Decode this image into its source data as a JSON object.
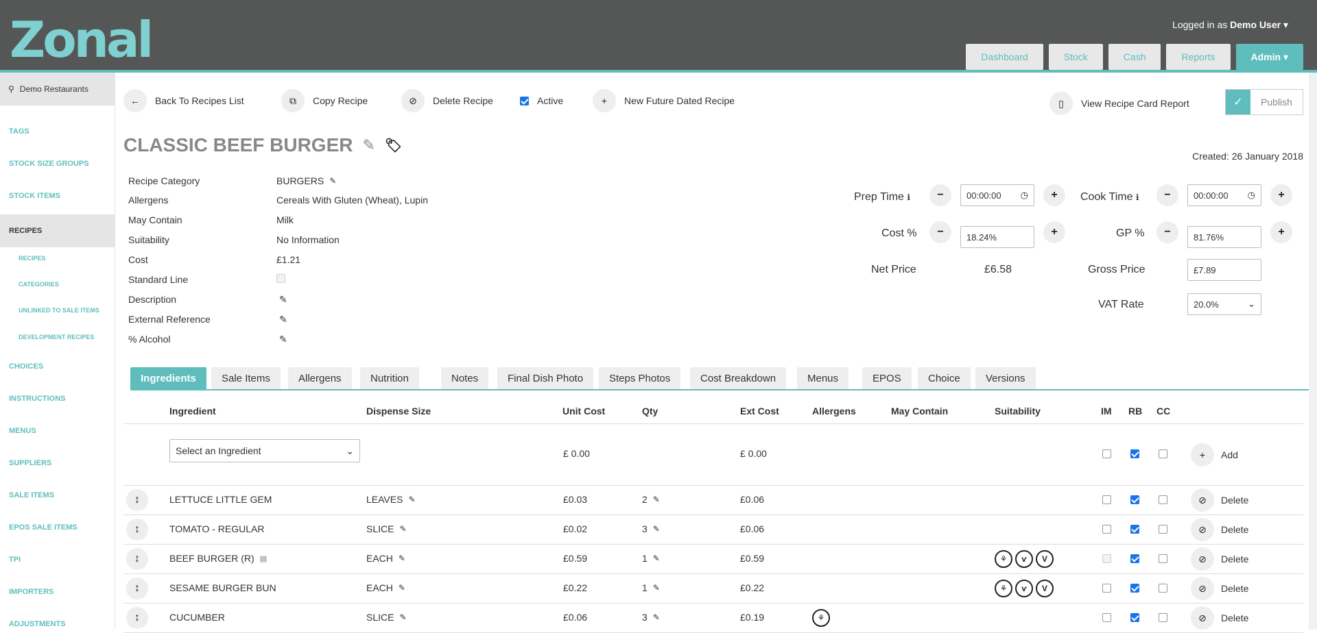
{
  "header": {
    "logo": "Zonal",
    "user_prefix": "Logged in as",
    "user_name": "Demo User",
    "nav": [
      "Dashboard",
      "Stock",
      "Cash",
      "Reports",
      "Admin"
    ]
  },
  "sidebar": {
    "site": "Demo Restaurants",
    "items": [
      "TAGS",
      "STOCK SIZE GROUPS",
      "STOCK ITEMS",
      "RECIPES",
      "CHOICES",
      "INSTRUCTIONS",
      "MENUS",
      "SUPPLIERS",
      "SALE ITEMS",
      "EPOS SALE ITEMS",
      "TPI",
      "IMPORTERS",
      "ADJUSTMENTS"
    ],
    "sub_items": [
      "RECIPES",
      "CATEGORIES",
      "UNLINKED TO SALE ITEMS",
      "DEVELOPMENT RECIPES"
    ]
  },
  "toolbar": {
    "back": "Back To Recipes List",
    "copy": "Copy Recipe",
    "delete": "Delete Recipe",
    "active": "Active",
    "new_future": "New Future Dated Recipe",
    "view_report": "View Recipe Card Report",
    "publish": "Publish"
  },
  "recipe": {
    "title": "CLASSIC BEEF BURGER",
    "created": "Created: 26 January 2018",
    "props": [
      {
        "label": "Recipe Category",
        "value": "BURGERS"
      },
      {
        "label": "Allergens",
        "value": "Cereals With Gluten (Wheat), Lupin"
      },
      {
        "label": "May Contain",
        "value": "Milk"
      },
      {
        "label": "Suitability",
        "value": "No Information"
      },
      {
        "label": "Cost",
        "value": "£1.21"
      },
      {
        "label": "Standard Line",
        "value": ""
      },
      {
        "label": "Description",
        "value": ""
      },
      {
        "label": "External Reference",
        "value": ""
      },
      {
        "label": "% Alcohol",
        "value": ""
      }
    ]
  },
  "pricing": {
    "prep_time_label": "Prep Time",
    "prep_time": "00:00:00",
    "cook_time_label": "Cook Time",
    "cook_time": "00:00:00",
    "cost_pct_label": "Cost %",
    "cost_pct": "18.24%",
    "gp_pct_label": "GP %",
    "gp_pct": "81.76%",
    "net_price_label": "Net Price",
    "net_price": "£6.58",
    "gross_price_label": "Gross Price",
    "gross_price": "£7.89",
    "vat_label": "VAT Rate",
    "vat": "20.0%"
  },
  "tabs": [
    "Ingredients",
    "Sale Items",
    "Allergens",
    "Nutrition",
    "Notes",
    "Final Dish Photo",
    "Steps Photos",
    "Cost Breakdown",
    "Menus",
    "EPOS",
    "Choice",
    "Versions"
  ],
  "table": {
    "columns": [
      "Ingredient",
      "Dispense Size",
      "Unit Cost",
      "Qty",
      "Ext Cost",
      "Allergens",
      "May Contain",
      "Suitability",
      "IM",
      "RB",
      "CC"
    ],
    "new_row": {
      "placeholder": "Select an Ingredient",
      "unit_cost": "£ 0.00",
      "ext_cost": "£ 0.00",
      "action": "Add"
    },
    "rows": [
      {
        "ingredient": "LETTUCE LITTLE GEM",
        "size": "LEAVES",
        "unit_cost": "£0.03",
        "qty": "2",
        "ext_cost": "£0.06",
        "action": "Delete"
      },
      {
        "ingredient": "TOMATO - REGULAR",
        "size": "SLICE",
        "unit_cost": "£0.02",
        "qty": "3",
        "ext_cost": "£0.06",
        "action": "Delete"
      },
      {
        "ingredient": "BEEF BURGER (R)",
        "size": "EACH",
        "unit_cost": "£0.59",
        "qty": "1",
        "ext_cost": "£0.59",
        "action": "Delete"
      },
      {
        "ingredient": "SESAME BURGER BUN",
        "size": "EACH",
        "unit_cost": "£0.22",
        "qty": "1",
        "ext_cost": "£0.22",
        "action": "Delete"
      },
      {
        "ingredient": "CUCUMBER",
        "size": "SLICE",
        "unit_cost": "£0.06",
        "qty": "3",
        "ext_cost": "£0.19",
        "action": "Delete"
      }
    ]
  }
}
